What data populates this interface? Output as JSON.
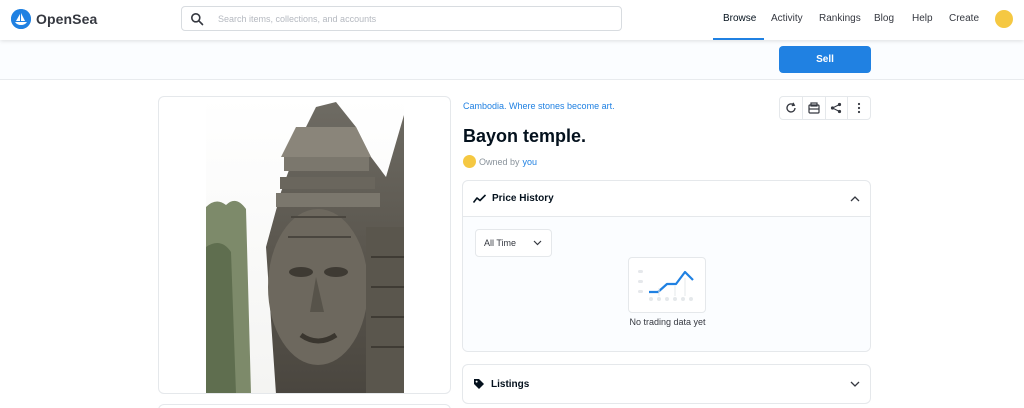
{
  "header": {
    "brand": "OpenSea",
    "search_placeholder": "Search items, collections, and accounts",
    "nav": [
      "Browse",
      "Activity",
      "Rankings",
      "Blog",
      "Help",
      "Create"
    ],
    "active_nav": "Browse"
  },
  "actions": {
    "sell_label": "Sell"
  },
  "item": {
    "collection": "Cambodia. Where stones become art.",
    "title": "Bayon temple.",
    "owned_by_prefix": "Owned by",
    "owner": "you"
  },
  "price_history": {
    "title": "Price History",
    "range": "All Time",
    "empty_text": "No trading data yet"
  },
  "listings": {
    "title": "Listings"
  },
  "colors": {
    "accent": "#2081e2",
    "avatar": "#f5c842"
  },
  "icons": [
    "opensea-logo-icon",
    "search-icon",
    "refresh-icon",
    "transfer-icon",
    "share-icon",
    "more-icon",
    "trend-icon",
    "chevron-up-icon",
    "chevron-down-icon",
    "tag-icon"
  ]
}
